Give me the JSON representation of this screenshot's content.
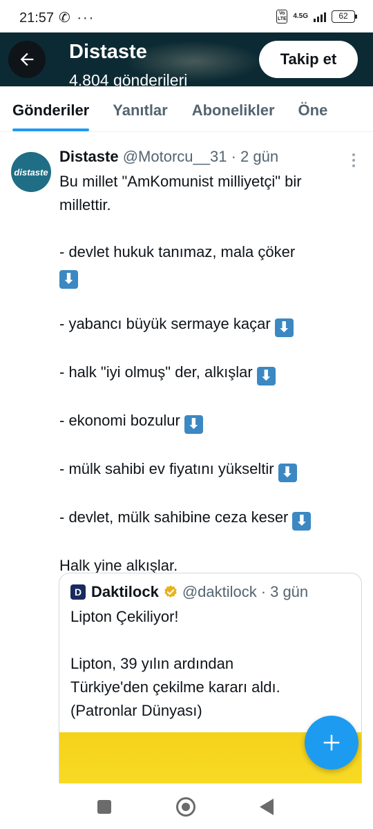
{
  "status_bar": {
    "time": "21:57",
    "left_icons": "✆ ···",
    "volte": "Vo LTE",
    "network": "4.5G",
    "battery": "62"
  },
  "header": {
    "name": "Distaste",
    "posts_count": "4.804 gönderileri",
    "follow_label": "Takip et"
  },
  "tabs": [
    {
      "label": "Gönderiler",
      "active": true
    },
    {
      "label": "Yanıtlar",
      "active": false
    },
    {
      "label": "Abonelikler",
      "active": false
    },
    {
      "label": "Öne",
      "active": false
    }
  ],
  "tweet": {
    "avatar_text": "distaste",
    "name": "Distaste",
    "handle": "@Motorcu__31",
    "separator": "·",
    "time": "2 gün",
    "lines": [
      {
        "text": "Bu millet \"AmKomunist milliyetçi\" bir",
        "arrow": false
      },
      {
        "text": "millettir.",
        "arrow": false
      },
      {
        "text": "",
        "arrow": false
      },
      {
        "text": "- devlet hukuk tanımaz, mala çöker",
        "arrow": false
      },
      {
        "text": "",
        "arrow": true
      },
      {
        "text": "",
        "arrow": false
      },
      {
        "text": "- yabancı büyük sermaye kaçar",
        "arrow": true
      },
      {
        "text": "",
        "arrow": false
      },
      {
        "text": "- halk \"iyi olmuş\" der, alkışlar",
        "arrow": true
      },
      {
        "text": "",
        "arrow": false
      },
      {
        "text": "- ekonomi bozulur",
        "arrow": true
      },
      {
        "text": "",
        "arrow": false
      },
      {
        "text": "- mülk sahibi ev fiyatını yükseltir",
        "arrow": true
      },
      {
        "text": "",
        "arrow": false
      },
      {
        "text": "- devlet, mülk sahibine ceza keser",
        "arrow": true
      },
      {
        "text": "",
        "arrow": false
      },
      {
        "text": "Halk yine alkışlar.",
        "arrow": false
      }
    ],
    "arrow_glyph": "⬇"
  },
  "quote": {
    "logo_text": "D",
    "name": "Daktilock",
    "handle": "@daktilock",
    "separator": "·",
    "time": "3 gün",
    "lines": [
      "Lipton Çekiliyor!",
      "",
      "Lipton, 39 yılın ardından",
      "Türkiye'den çekilme kararı aldı.",
      "(Patronlar Dünyası)"
    ]
  },
  "colors": {
    "accent": "#1d9bf0",
    "header_bg": "#0c2a33",
    "verified": "#e8b21b",
    "quote_image": "#f8dc27"
  },
  "icons": [
    "back-arrow-icon",
    "more-icon",
    "verified-badge-icon",
    "compose-plus-icon",
    "recents-icon",
    "home-icon",
    "back-icon"
  ]
}
